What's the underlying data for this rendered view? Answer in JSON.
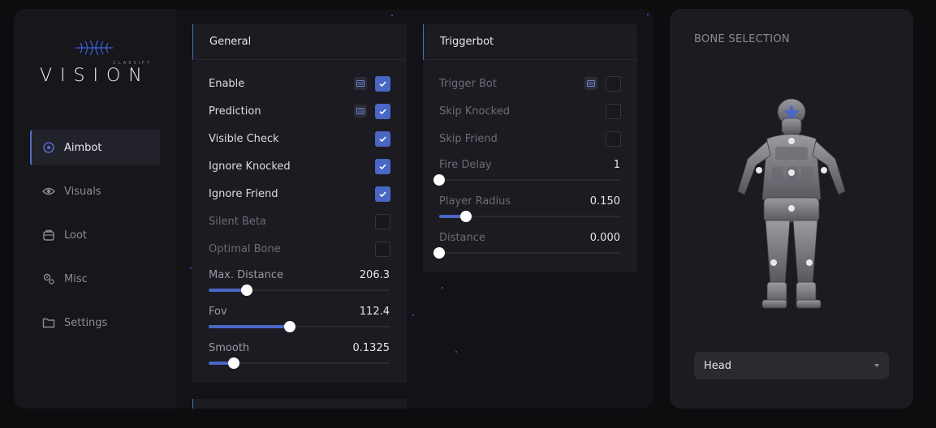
{
  "app": {
    "brand": "VISION",
    "brand_sub": "CLASSIFY",
    "accent_color": "#4a67c6"
  },
  "sidebar": {
    "items": [
      {
        "label": "Aimbot",
        "icon": "crosshair-icon",
        "active": true
      },
      {
        "label": "Visuals",
        "icon": "eye-icon",
        "active": false
      },
      {
        "label": "Loot",
        "icon": "backpack-icon",
        "active": false
      },
      {
        "label": "Misc",
        "icon": "cogs-icon",
        "active": false
      },
      {
        "label": "Settings",
        "icon": "folder-icon",
        "active": false
      }
    ]
  },
  "general": {
    "title": "General",
    "toggles": [
      {
        "label": "Enable",
        "checked": true,
        "keybind": true,
        "enabled": true
      },
      {
        "label": "Prediction",
        "checked": true,
        "keybind": true,
        "enabled": true
      },
      {
        "label": "Visible Check",
        "checked": true,
        "keybind": false,
        "enabled": true
      },
      {
        "label": "Ignore Knocked",
        "checked": true,
        "keybind": false,
        "enabled": true
      },
      {
        "label": "Ignore Friend",
        "checked": true,
        "keybind": false,
        "enabled": true
      },
      {
        "label": "Silent Beta",
        "checked": false,
        "keybind": false,
        "enabled": false
      },
      {
        "label": "Optimal Bone",
        "checked": false,
        "keybind": false,
        "enabled": false
      }
    ],
    "sliders": [
      {
        "label": "Max. Distance",
        "value": "206.3",
        "fraction": 0.21
      },
      {
        "label": "Fov",
        "value": "112.4",
        "fraction": 0.45
      },
      {
        "label": "Smooth",
        "value": "0.1325",
        "fraction": 0.14
      }
    ]
  },
  "triggerbot": {
    "title": "Triggerbot",
    "toggles": [
      {
        "label": "Trigger Bot",
        "checked": false,
        "keybind": true,
        "enabled": false
      },
      {
        "label": "Skip Knocked",
        "checked": false,
        "keybind": false,
        "enabled": false
      },
      {
        "label": "Skip Friend",
        "checked": false,
        "keybind": false,
        "enabled": false
      }
    ],
    "sliders": [
      {
        "label": "Fire Delay",
        "value": "1",
        "fraction": 0.0
      },
      {
        "label": "Player Radius",
        "value": "0.150",
        "fraction": 0.15
      },
      {
        "label": "Distance",
        "value": "0.000",
        "fraction": 0.0
      }
    ]
  },
  "bone_selection": {
    "title": "BONE SELECTION",
    "selected": "Head",
    "selected_bone_color": "#4a67c6"
  }
}
